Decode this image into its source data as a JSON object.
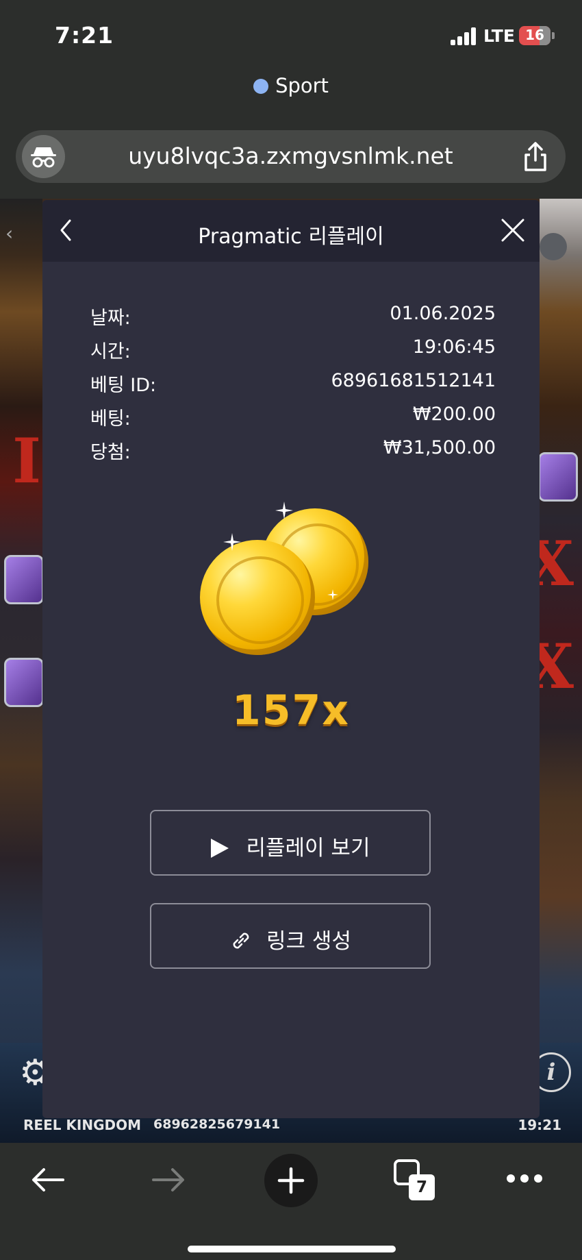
{
  "status_bar": {
    "time": "7:21",
    "carrier": "LTE",
    "battery": "16"
  },
  "tab_group": {
    "label": "Sport"
  },
  "address_bar": {
    "url": "uyu8lvqc3a.zxmgvsnlmk.net"
  },
  "panel": {
    "title": "Pragmatic 리플레이",
    "info": [
      {
        "label": "날짜:",
        "value": "01.06.2025"
      },
      {
        "label": "시간:",
        "value": "19:06:45"
      },
      {
        "label": "베팅 ID:",
        "value": "68961681512141"
      },
      {
        "label": "베팅:",
        "value": "₩200.00"
      },
      {
        "label": "당첨:",
        "value": "₩31,500.00"
      }
    ],
    "multiplier": "157x",
    "replay_button": "리플레이 보기",
    "link_button": "링크 생성"
  },
  "game_footer": {
    "brand": "REEL KINGDOM",
    "round_id": "68962825679141",
    "time": "19:21"
  },
  "toolbar": {
    "tab_count": "7"
  },
  "colors": {
    "panel_bg": "#2f2f3e",
    "panel_header": "#242432",
    "multiplier": "#f6bd28",
    "tab_dot": "#8db4f3",
    "battery": "#e34f4f"
  }
}
